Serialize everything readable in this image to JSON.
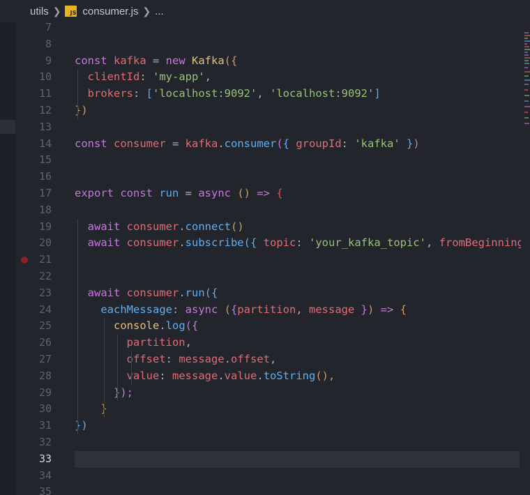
{
  "breadcrumb": {
    "folder": "utils",
    "file_icon_label": "JS",
    "file": "consumer.js",
    "ellipsis": "..."
  },
  "editor": {
    "active_line": 33,
    "breakpoint_line": 21,
    "lines": [
      {
        "n": "7",
        "tokens": []
      },
      {
        "n": "8",
        "tokens": []
      },
      {
        "n": "9",
        "tokens": [
          [
            "const ",
            "kw"
          ],
          [
            "kafka",
            "var"
          ],
          [
            " = ",
            "punc"
          ],
          [
            "new ",
            "kw"
          ],
          [
            "Kafka",
            "cls"
          ],
          [
            "({",
            "p1"
          ]
        ]
      },
      {
        "n": "10",
        "tokens": [
          [
            "  clientId",
            "var"
          ],
          [
            ": ",
            "punc"
          ],
          [
            "'my-app'",
            "str"
          ],
          [
            ",",
            "punc"
          ]
        ]
      },
      {
        "n": "11",
        "tokens": [
          [
            "  brokers",
            "var"
          ],
          [
            ": ",
            "punc"
          ],
          [
            "[",
            "p3"
          ],
          [
            "'localhost:9092'",
            "str"
          ],
          [
            ", ",
            "punc"
          ],
          [
            "'localhost:9092'",
            "str"
          ],
          [
            "]",
            "p3"
          ]
        ]
      },
      {
        "n": "12",
        "tokens": [
          [
            "})",
            "p1"
          ]
        ]
      },
      {
        "n": "13",
        "tokens": []
      },
      {
        "n": "14",
        "tokens": [
          [
            "const ",
            "kw"
          ],
          [
            "consumer",
            "var"
          ],
          [
            " = ",
            "punc"
          ],
          [
            "kafka",
            "var"
          ],
          [
            ".",
            "punc"
          ],
          [
            "consumer",
            "fn"
          ],
          [
            "(",
            "p2"
          ],
          [
            "{ ",
            "p3"
          ],
          [
            "groupId",
            "var"
          ],
          [
            ": ",
            "punc"
          ],
          [
            "'kafka'",
            "str"
          ],
          [
            " }",
            "p3"
          ],
          [
            ")",
            "p2"
          ]
        ]
      },
      {
        "n": "15",
        "tokens": []
      },
      {
        "n": "16",
        "tokens": []
      },
      {
        "n": "17",
        "tokens": [
          [
            "export ",
            "kw"
          ],
          [
            "const ",
            "kw"
          ],
          [
            "run",
            "fn"
          ],
          [
            " = ",
            "punc"
          ],
          [
            "async ",
            "kw"
          ],
          [
            "() ",
            "p1"
          ],
          [
            "=> ",
            "kw"
          ],
          [
            "{",
            "err"
          ]
        ]
      },
      {
        "n": "18",
        "tokens": []
      },
      {
        "n": "19",
        "tokens": [
          [
            "  await ",
            "kw"
          ],
          [
            "consumer",
            "var"
          ],
          [
            ".",
            "punc"
          ],
          [
            "connect",
            "fn"
          ],
          [
            "()",
            "p1"
          ]
        ]
      },
      {
        "n": "20",
        "tokens": [
          [
            "  await ",
            "kw"
          ],
          [
            "consumer",
            "var"
          ],
          [
            ".",
            "punc"
          ],
          [
            "subscribe",
            "fn"
          ],
          [
            "({ ",
            "p3"
          ],
          [
            "topic",
            "var"
          ],
          [
            ": ",
            "punc"
          ],
          [
            "'your_kafka_topic'",
            "str"
          ],
          [
            ", ",
            "punc"
          ],
          [
            "fromBeginning",
            "var"
          ]
        ]
      },
      {
        "n": "21",
        "tokens": []
      },
      {
        "n": "22",
        "tokens": []
      },
      {
        "n": "23",
        "tokens": [
          [
            "  await ",
            "kw"
          ],
          [
            "consumer",
            "var"
          ],
          [
            ".",
            "punc"
          ],
          [
            "run",
            "fn"
          ],
          [
            "({",
            "p3"
          ]
        ]
      },
      {
        "n": "24",
        "tokens": [
          [
            "    eachMessage",
            "fn"
          ],
          [
            ": ",
            "punc"
          ],
          [
            "async ",
            "kw"
          ],
          [
            "(",
            "p1"
          ],
          [
            "{",
            "p2"
          ],
          [
            "partition",
            "var"
          ],
          [
            ", ",
            "punc"
          ],
          [
            "message",
            "var"
          ],
          [
            " }",
            "p2"
          ],
          [
            ")",
            "p1"
          ],
          [
            " => ",
            "kw"
          ],
          [
            "{",
            "p1"
          ]
        ]
      },
      {
        "n": "25",
        "tokens": [
          [
            "      console",
            "cls"
          ],
          [
            ".",
            "punc"
          ],
          [
            "log",
            "fn"
          ],
          [
            "({",
            "p2"
          ]
        ]
      },
      {
        "n": "26",
        "tokens": [
          [
            "        partition",
            "var"
          ],
          [
            ",",
            "punc"
          ]
        ]
      },
      {
        "n": "27",
        "tokens": [
          [
            "        offset",
            "var"
          ],
          [
            ": ",
            "punc"
          ],
          [
            "message",
            "var"
          ],
          [
            ".",
            "punc"
          ],
          [
            "offset",
            "var"
          ],
          [
            ",",
            "punc"
          ]
        ]
      },
      {
        "n": "28",
        "tokens": [
          [
            "        value",
            "var"
          ],
          [
            ": ",
            "punc"
          ],
          [
            "message",
            "var"
          ],
          [
            ".",
            "punc"
          ],
          [
            "value",
            "var"
          ],
          [
            ".",
            "punc"
          ],
          [
            "toString",
            "fn"
          ],
          [
            "(),",
            "p1"
          ]
        ]
      },
      {
        "n": "29",
        "tokens": [
          [
            "      });",
            "p2"
          ]
        ]
      },
      {
        "n": "30",
        "tokens": [
          [
            "    }",
            "p1"
          ]
        ]
      },
      {
        "n": "31",
        "tokens": [
          [
            "})",
            "p3"
          ]
        ]
      },
      {
        "n": "32",
        "tokens": []
      },
      {
        "n": "33",
        "tokens": []
      },
      {
        "n": "34",
        "tokens": []
      },
      {
        "n": "35",
        "tokens": []
      }
    ]
  },
  "colors": {
    "background": "#22252c",
    "keyword": "#c678dd",
    "variable": "#e06c75",
    "function": "#61afef",
    "string": "#98c379",
    "class": "#e5c07b",
    "bracket_gold": "#d19a66",
    "error_brace": "#e05252",
    "active_line": "#2c313a",
    "breakpoint": "#8a2228"
  }
}
